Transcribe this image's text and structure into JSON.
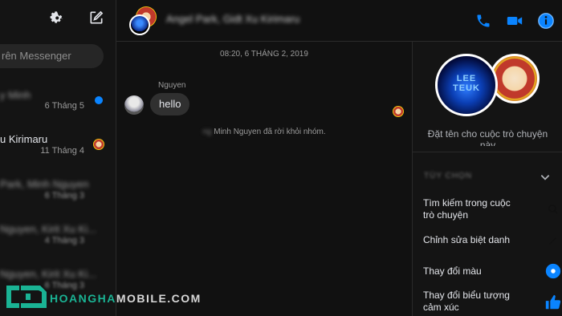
{
  "sidebar": {
    "search_placeholder": "rên Messenger",
    "conversations": [
      {
        "name": "y Minh",
        "date": "6 Tháng 5",
        "name_blurred": true,
        "date_blurred": false,
        "unread": true
      },
      {
        "name": "u Kirimaru",
        "date": "11 Tháng 4",
        "name_blurred": false,
        "date_blurred": false,
        "unread": false
      },
      {
        "name": "Park, Minh Nguyen",
        "date": "6 Tháng 3",
        "name_blurred": true,
        "date_blurred": true
      },
      {
        "name": "Nguyen, Kirit Xu Ki...",
        "date": "4 Tháng 3",
        "name_blurred": true,
        "date_blurred": true
      },
      {
        "name": "Nguyen, Kirit Xu Ki...",
        "date": "6 Tháng 3",
        "name_blurred": true,
        "date_blurred": true
      }
    ]
  },
  "header": {
    "title": "Angel Park, Gidt Xu Kirimaru",
    "icons": [
      "phone-icon",
      "video-icon",
      "info-icon"
    ],
    "accent": "#0a84ff"
  },
  "chat": {
    "timestamp": "08:20, 6 THÁNG 2, 2019",
    "sender": "Nguyen",
    "message": "hello",
    "system_prefix": "ng",
    "system_message": "Minh Nguyen đã rời khỏi nhóm."
  },
  "details": {
    "avatar_text_1": "LEE",
    "avatar_text_2": "TEUK",
    "name_prompt": "Đặt tên cho cuộc trò chuyện này",
    "options_header": "TÙY CHỌN",
    "options": [
      {
        "label": "Tìm kiếm trong cuộc trò chuyện",
        "icon": "search-icon"
      },
      {
        "label": "Chỉnh sửa biệt danh",
        "icon": "pencil-icon"
      },
      {
        "label": "Thay đổi màu",
        "icon": "color-dot-icon"
      },
      {
        "label": "Thay đổi biểu tượng cảm xúc",
        "icon": "thumbs-up-icon"
      }
    ]
  },
  "watermark": {
    "part1": "HOANGHA",
    "part2": "MOBILE.COM"
  }
}
